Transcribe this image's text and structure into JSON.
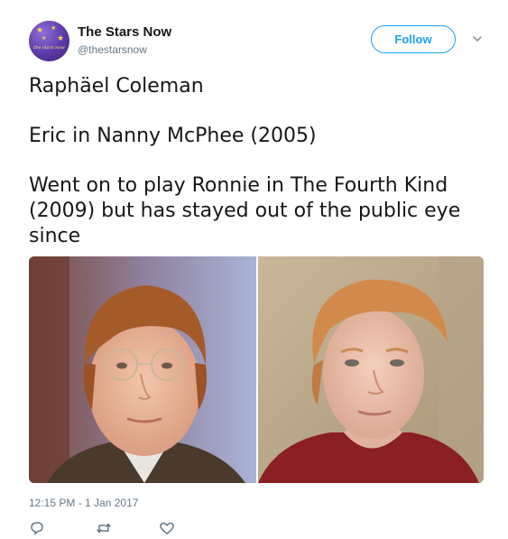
{
  "user": {
    "name": "The Stars Now",
    "handle": "@thestarsnow",
    "avatar_text": "the stars now"
  },
  "follow_label": "Follow",
  "tweet": {
    "line1": "Raphäel Coleman",
    "line2": "Eric in Nanny McPhee (2005)",
    "line3": "Went on to play Ronnie in The Fourth Kind (2009) but has stayed out of the public eye since"
  },
  "timestamp": "12:15 PM - 1 Jan 2017",
  "icons": {
    "reply": "reply-icon",
    "retweet": "retweet-icon",
    "like": "like-icon",
    "more": "chevron-down-icon"
  },
  "colors": {
    "accent": "#1da1f2",
    "muted": "#657786",
    "text": "#14171a"
  }
}
